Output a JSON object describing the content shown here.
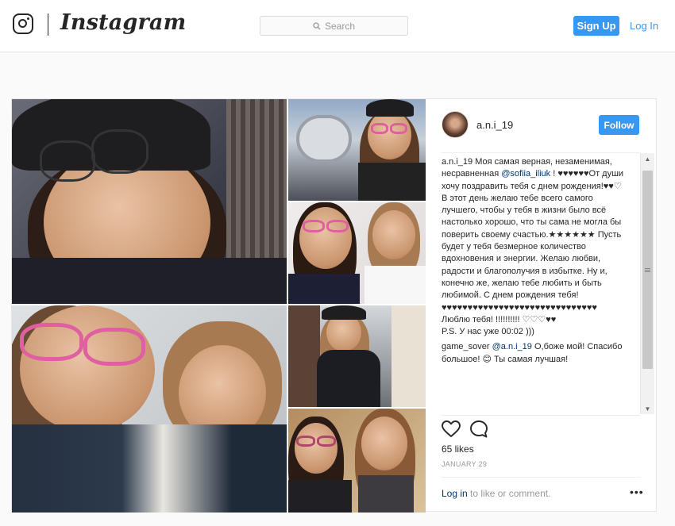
{
  "header": {
    "logo_text": "Instagram",
    "search_placeholder": "Search",
    "signup_label": "Sign Up",
    "login_label": "Log In"
  },
  "post": {
    "author": "a.n.i_19",
    "follow_label": "Follow",
    "caption": {
      "user": "a.n.i_19",
      "part1": " Моя самая верная, незаменимая, несравненная ",
      "mention": "@sofiia_iliuk",
      "part2": " ! ♥♥♥♥♥♥От души хочу поздравить тебя с днем рождения!♥♥♡ В этот день желаю тебе всего самого лучшего, чтобы у тебя в жизни было всё настолько хорошо, что ты сама не могла бы поверить своему счастью.★★★★★★ Пусть будет у тебя безмерное количество вдохновения и энергии. Желаю любви, радости и благополучия в избытке. Ну и, конечно же, желаю тебе любить и быть любимой. С днем рождения тебя!♥♥♥♥♥♥♥♥♥♥♥♥♥♥♥♥♥♥♥♥♥♥♥♥♥♥♥♥♥♥",
      "line2": "Люблю тебя! !!!!!!!!!! ♡♡♡♥♥",
      "line3": "P.S. У нас уже 00:02 )))"
    },
    "comment": {
      "user": "game_sover",
      "mention": "@a.n.i_19",
      "text": " О,боже мой! Спасибо большое! 😊 Ты самая лучшая!"
    },
    "likes": "65 likes",
    "date": "JANUARY 29",
    "login_link": "Log in",
    "login_suffix": " to like or comment.",
    "more_label": "•••"
  },
  "colors": {
    "accent": "#3897f0",
    "link": "#003569",
    "muted": "#999999"
  },
  "icons": [
    "instagram-camera-icon",
    "search-icon",
    "heart-icon",
    "comment-icon",
    "more-options-icon"
  ]
}
